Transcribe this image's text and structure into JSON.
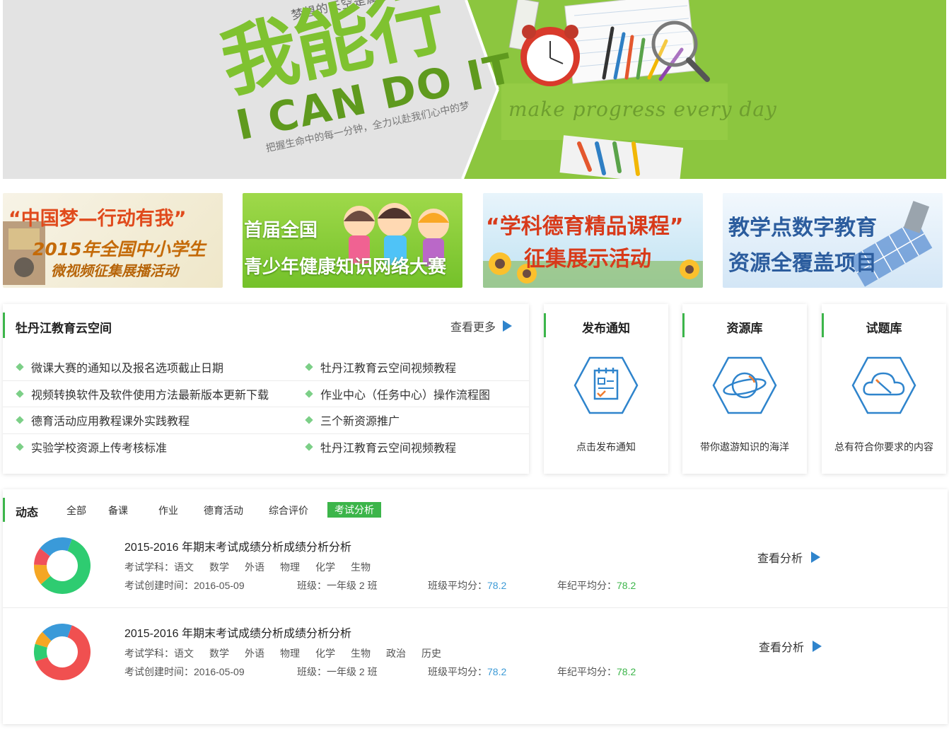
{
  "hero": {
    "dream_line": "梦想的天空是属于我的!",
    "title": "我能行",
    "english": "I CAN DO IT",
    "subline": "把握生命中的每一分钟，全力以赴我们心中的梦",
    "motto": "make progress every day",
    "colors": {
      "green": "#8cc63f",
      "gray": "#e3e3e3"
    }
  },
  "promos": [
    {
      "line1": "“中国梦—行动有我”",
      "line2": "2015年全国中小学生",
      "line3": "微视频征集展播活动"
    },
    {
      "line1": "首届全国",
      "line2": "青少年健康知识网络大赛"
    },
    {
      "line1": "“学科德育精品课程”",
      "line2": "征集展示活动"
    },
    {
      "line1": "教学点数字教育",
      "line2": "资源全覆盖项目"
    }
  ],
  "news": {
    "title": "牡丹江教育云空间",
    "more_label": "查看更多",
    "rows": [
      [
        "微课大赛的通知以及报名选项截止日期",
        "牡丹江教育云空间视频教程"
      ],
      [
        "视频转换软件及软件使用方法最新版本更新下载",
        "作业中心（任务中心）操作流程图"
      ],
      [
        "德育活动应用教程课外实践教程",
        "三个新资源推广"
      ],
      [
        "实验学校资源上传考核标准",
        "牡丹江教育云空间视频教程"
      ]
    ]
  },
  "features": [
    {
      "title": "发布通知",
      "desc": "点击发布通知",
      "icon": "notice-clipboard-icon"
    },
    {
      "title": "资源库",
      "desc": "带你遨游知识的海洋",
      "icon": "planet-icon"
    },
    {
      "title": "试题库",
      "desc": "总有符合你要求的内容",
      "icon": "cloud-pencil-icon"
    }
  ],
  "activity": {
    "title": "动态",
    "filters": [
      "全部",
      "备课",
      "作业",
      "德育活动",
      "综合评价",
      "考试分析"
    ],
    "active_filter": "考试分析",
    "exams": [
      {
        "title": "2015-2016 年期末考试成绩分析成绩分析分析",
        "subjects_label": "考试学科：",
        "subjects": [
          "语文",
          "数学",
          "外语",
          "物理",
          "化学",
          "生物"
        ],
        "created_label": "考试创建时间：",
        "created": "2016-05-09",
        "class_label": "班级：",
        "class": "一年级 2 班",
        "class_avg_label": "班级平均分：",
        "class_avg": "78.2",
        "grade_avg_label": "年纪平均分：",
        "grade_avg": "78.2",
        "link_label": "查看分析",
        "donut": [
          {
            "value": 58,
            "color": "#2ecc71"
          },
          {
            "value": 12,
            "color": "#f5a623"
          },
          {
            "value": 10,
            "color": "#f0505a"
          },
          {
            "value": 20,
            "color": "#3a9ad9"
          }
        ]
      },
      {
        "title": "2015-2016 年期末考试成绩分析成绩分析分析",
        "subjects_label": "考试学科：",
        "subjects": [
          "语文",
          "数学",
          "外语",
          "物理",
          "化学",
          "生物",
          "政治",
          "历史"
        ],
        "created_label": "考试创建时间：",
        "created": "2016-05-09",
        "class_label": "班级：",
        "class": "一年级 2 班",
        "class_avg_label": "班级平均分：",
        "class_avg": "78.2",
        "grade_avg_label": "年纪平均分：",
        "grade_avg": "78.2",
        "link_label": "查看分析",
        "donut": [
          {
            "value": 64,
            "color": "#f05050"
          },
          {
            "value": 10,
            "color": "#2ecc71"
          },
          {
            "value": 8,
            "color": "#f5a623"
          },
          {
            "value": 18,
            "color": "#3a9ad9"
          }
        ]
      }
    ]
  }
}
